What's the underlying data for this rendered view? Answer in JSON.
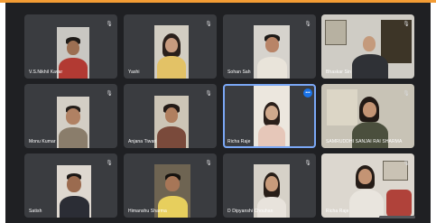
{
  "header": {
    "accent_color": "#f39c34"
  },
  "participants": [
    {
      "name": "V.S.Nikhil Kavar",
      "mic_icon": "mic-off-icon"
    },
    {
      "name": "Yashi",
      "mic_icon": "mic-off-icon"
    },
    {
      "name": "Sohan Sah",
      "mic_icon": "mic-off-icon"
    },
    {
      "name": "Bhaskar Sin",
      "mic_icon": "mic-off-icon"
    },
    {
      "name": "Monu Kumar",
      "mic_icon": "mic-off-icon"
    },
    {
      "name": "Anjana Tiwari",
      "mic_icon": "mic-off-icon"
    },
    {
      "name": "Richa Raje",
      "mic_icon": "speaking-icon"
    },
    {
      "name": "SAMRUDDHI SANJAI RAI SHARMA",
      "mic_icon": "mic-off-icon"
    },
    {
      "name": "Satish",
      "mic_icon": "mic-off-icon"
    },
    {
      "name": "Himanshu Sharma",
      "mic_icon": "mic-off-icon"
    },
    {
      "name": "D Dipyanshi Chouhan",
      "mic_icon": "mic-off-icon"
    },
    {
      "name": "Richa Raje",
      "mic_icon": "mic-off-icon"
    }
  ]
}
